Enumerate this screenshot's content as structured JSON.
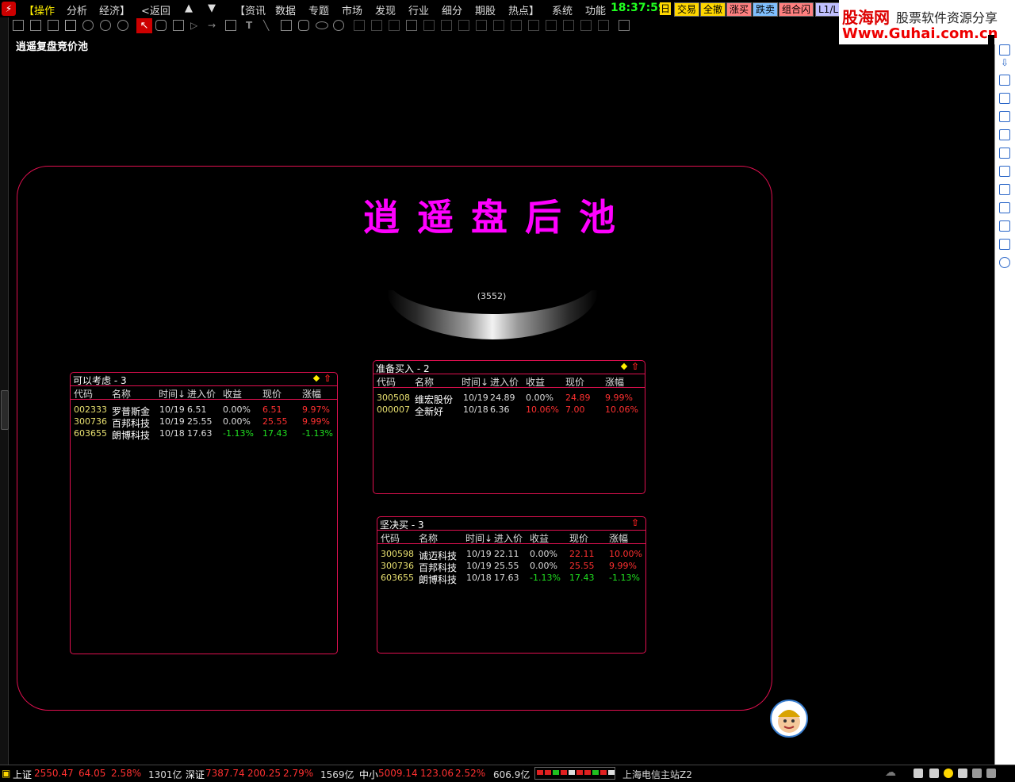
{
  "menu": {
    "items": [
      "【操作",
      "分析",
      "经济】",
      "<返回",
      "▲",
      "▼",
      "【资讯",
      "数据",
      "专题",
      "市场",
      "发现",
      "行业",
      "细分",
      "期股",
      "热点】",
      "系统",
      "功能"
    ],
    "clock": "18:37:59",
    "day": "日",
    "quick_buttons": [
      {
        "label": "交易",
        "color": "#ffd700"
      },
      {
        "label": "全撤",
        "color": "#ffd700"
      },
      {
        "label": "涨买",
        "color": "#ff8080"
      },
      {
        "label": "跌卖",
        "color": "#80c0ff"
      },
      {
        "label": "组合闪",
        "color": "#ff8080"
      },
      {
        "label": "L1/L2",
        "color": "#c0c0ff"
      }
    ]
  },
  "watermark": {
    "logo": "股海网",
    "tagline": "股票软件资源分享",
    "url": "Www.Guhai.com.cn"
  },
  "page": {
    "title": "逍遥复盘竞价池"
  },
  "pool": {
    "heading": "逍遥盘后池",
    "count": "(3552)"
  },
  "columns": [
    "代码",
    "名称",
    "时间↓",
    "进入价",
    "收益",
    "现价",
    "涨幅"
  ],
  "panels": {
    "consider": {
      "title": "可以考虑 - 3",
      "rows": [
        {
          "code": "002333",
          "name": "罗普斯金",
          "time": "10/19",
          "entry": "6.51",
          "gain": "0.00%",
          "price": "6.51",
          "change": "9.97%",
          "gain_color": "white",
          "price_color": "red",
          "change_color": "red"
        },
        {
          "code": "300736",
          "name": "百邦科技",
          "time": "10/19",
          "entry": "25.55",
          "gain": "0.00%",
          "price": "25.55",
          "change": "9.99%",
          "gain_color": "white",
          "price_color": "red",
          "change_color": "red"
        },
        {
          "code": "603655",
          "name": "朗博科技",
          "time": "10/18",
          "entry": "17.63",
          "gain": "-1.13%",
          "price": "17.43",
          "change": "-1.13%",
          "gain_color": "green",
          "price_color": "green",
          "change_color": "green"
        }
      ]
    },
    "prepare": {
      "title": "准备买入 - 2",
      "rows": [
        {
          "code": "300508",
          "name": "维宏股份",
          "time": "10/19",
          "entry": "24.89",
          "gain": "0.00%",
          "price": "24.89",
          "change": "9.99%",
          "gain_color": "white",
          "price_color": "red",
          "change_color": "red"
        },
        {
          "code": "000007",
          "name": "全新好",
          "time": "10/18",
          "entry": "6.36",
          "gain": "10.06%",
          "price": "7.00",
          "change": "10.06%",
          "gain_color": "red",
          "price_color": "red",
          "change_color": "red"
        }
      ]
    },
    "buy": {
      "title": "坚决买 - 3",
      "rows": [
        {
          "code": "300598",
          "name": "诚迈科技",
          "time": "10/19",
          "entry": "22.11",
          "gain": "0.00%",
          "price": "22.11",
          "change": "10.00%",
          "gain_color": "white",
          "price_color": "red",
          "change_color": "red"
        },
        {
          "code": "300736",
          "name": "百邦科技",
          "time": "10/19",
          "entry": "25.55",
          "gain": "0.00%",
          "price": "25.55",
          "change": "9.99%",
          "gain_color": "white",
          "price_color": "red",
          "change_color": "red"
        },
        {
          "code": "603655",
          "name": "朗博科技",
          "time": "10/18",
          "entry": "17.63",
          "gain": "-1.13%",
          "price": "17.43",
          "change": "-1.13%",
          "gain_color": "green",
          "price_color": "green",
          "change_color": "green"
        }
      ]
    }
  },
  "status": {
    "sh_label": "上证",
    "sh_index": "2550.47",
    "sh_change": "64.05",
    "sh_pct": "2.58%",
    "sh_volume": "1301亿",
    "sz_label": "深证",
    "sz_index": "7387.74",
    "sz_change": "200.25",
    "sz_pct": "2.79%",
    "sz_volume": "1569亿",
    "zx_label": "中小",
    "zx_index": "5009.14",
    "zx_change": "123.06",
    "zx_pct": "2.52%",
    "zx_volume": "606.9亿",
    "server": "上海电信主站Z2"
  },
  "colors": {
    "accent_border": "#e01050",
    "pool_heading": "#ff00ff",
    "up": "#ff3030",
    "down": "#20e020",
    "code": "#e8e070"
  }
}
